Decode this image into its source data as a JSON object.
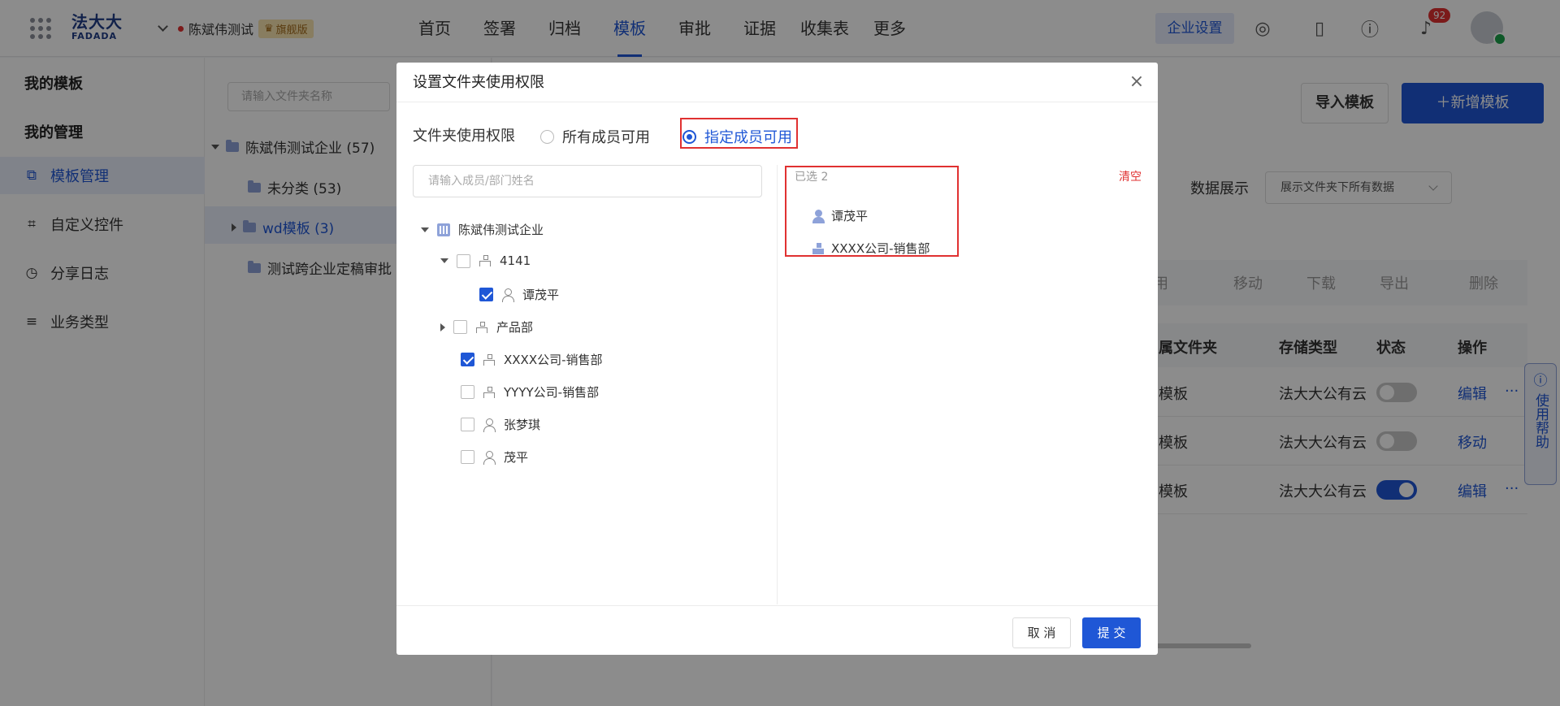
{
  "header": {
    "logo_cn": "法大大",
    "logo_en": "FADADA",
    "enterprise": "陈斌伟测试",
    "plan_badge": "旗舰版",
    "nav": [
      "首页",
      "签署",
      "归档",
      "模板",
      "审批",
      "证据",
      "收集表",
      "更多"
    ],
    "active_nav": "模板",
    "settings_label": "企业设置",
    "notification_count": "92"
  },
  "sidebar": {
    "section1": "我的模板",
    "section2": "我的管理",
    "items": [
      {
        "label": "模板管理",
        "icon": "template-icon"
      },
      {
        "label": "自定义控件",
        "icon": "control-icon"
      },
      {
        "label": "分享日志",
        "icon": "clock-icon"
      },
      {
        "label": "业务类型",
        "icon": "list-icon"
      }
    ]
  },
  "folder_tree": {
    "search_placeholder": "请输入文件夹名称",
    "nodes": [
      {
        "label": "陈斌伟测试企业 (57)"
      },
      {
        "label": "未分类 (53)"
      },
      {
        "label": "wd模板 (3)"
      },
      {
        "label": "测试跨企业定稿审批"
      }
    ]
  },
  "main": {
    "import_label": "导入模板",
    "add_label": "新增模板",
    "data_view_label": "数据展示",
    "data_view_value": "展示文件夹下所有数据",
    "toolbar": [
      "用",
      "移动",
      "下载",
      "导出",
      "删除"
    ],
    "columns": [
      "属文件夹",
      "存储类型",
      "状态",
      "操作"
    ],
    "rows": [
      {
        "folder": "模板",
        "storage": "法大大公有云",
        "enabled": false,
        "op": "编辑"
      },
      {
        "folder": "模板",
        "storage": "法大大公有云",
        "enabled": false,
        "op": "移动"
      },
      {
        "folder": "模板",
        "storage": "法大大公有云",
        "enabled": true,
        "op": "编辑"
      }
    ],
    "help_label": "使用帮助"
  },
  "modal": {
    "title": "设置文件夹使用权限",
    "permission_label": "文件夹使用权限",
    "option_all": "所有成员可用",
    "option_specified": "指定成员可用",
    "member_search_placeholder": "请输入成员/部门姓名",
    "tree": {
      "root": "陈斌伟测试企业",
      "dept_4141": "4141",
      "member_tan": "谭茂平",
      "dept_product": "产品部",
      "dept_xxxx": "XXXX公司-销售部",
      "dept_yyyy": "YYYY公司-销售部",
      "member_zhang": "张梦琪",
      "member_mao": "茂平"
    },
    "selected_header": "已选 2",
    "clear_label": "清空",
    "selected": [
      {
        "label": "谭茂平",
        "type": "user"
      },
      {
        "label": "XXXX公司-销售部",
        "type": "department"
      }
    ],
    "cancel_label": "取 消",
    "submit_label": "提 交"
  }
}
